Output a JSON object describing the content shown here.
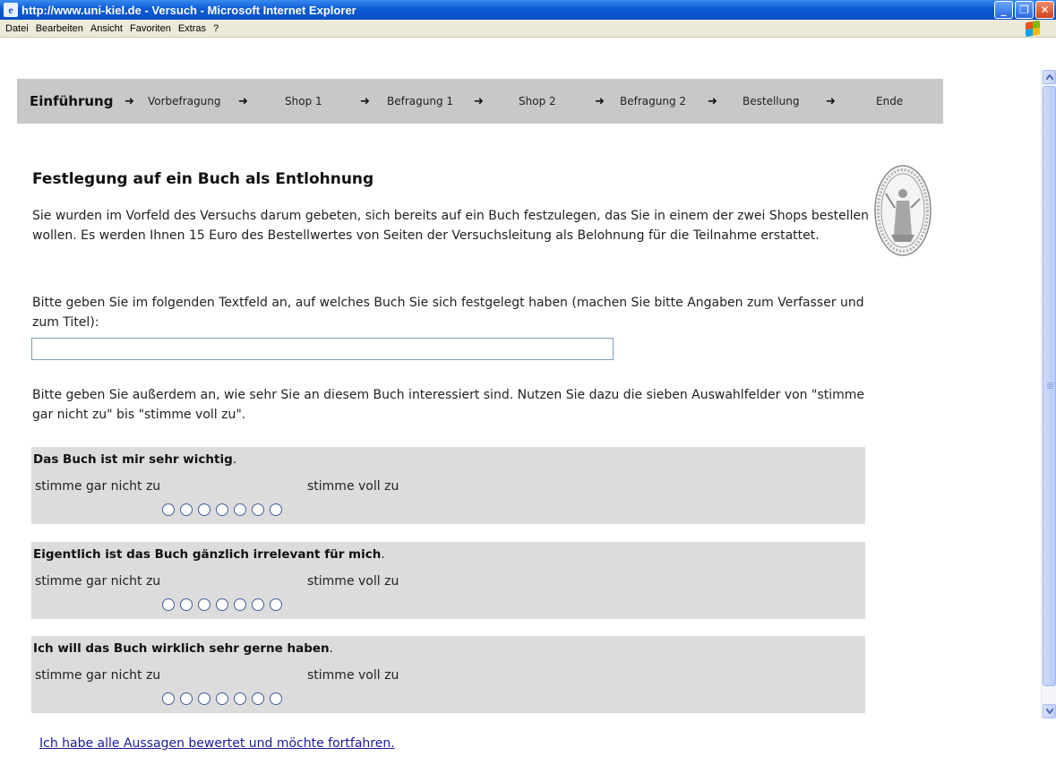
{
  "window": {
    "title": "http://www.uni-kiel.de - Versuch - Microsoft Internet Explorer",
    "app_icon": "e",
    "minimize_glyph": "_",
    "maximize_glyph": "❐",
    "close_glyph": "✕"
  },
  "menubar": {
    "items": [
      "Datei",
      "Bearbeiten",
      "Ansicht",
      "Favoriten",
      "Extras",
      "?"
    ]
  },
  "nav": {
    "arrow": "➜",
    "steps": [
      "Einführung",
      "Vorbefragung",
      "Shop 1",
      "Befragung 1",
      "Shop 2",
      "Befragung 2",
      "Bestellung",
      "Ende"
    ]
  },
  "content": {
    "title": "Festlegung auf ein Buch als Entlohnung",
    "intro": "Sie wurden im Vorfeld des Versuchs darum gebeten, sich bereits auf ein Buch festzulegen, das Sie in einem der zwei Shops bestellen wollen. Es werden Ihnen 15 Euro des Bestellwertes von Seiten der Versuchsleitung als Belohnung für die Teilnahme erstattet.",
    "input_prompt": "Bitte geben Sie im folgenden Textfeld an, auf welches Buch Sie sich festgelegt haben (machen Sie bitte Angaben zum Verfasser und zum Titel):",
    "book_input_value": "",
    "rating_prompt": "Bitte geben Sie außerdem an, wie sehr Sie an diesem Buch interessiert sind. Nutzen Sie dazu die sieben Auswahlfelder von \"stimme gar nicht zu\" bis \"stimme voll zu\".",
    "scale_low": "stimme gar nicht zu",
    "scale_high": "stimme voll zu",
    "questions": [
      {
        "text": "Das Buch ist mir sehr wichtig",
        "end": "."
      },
      {
        "text": "Eigentlich ist das Buch gänzlich irrelevant für mich",
        "end": "."
      },
      {
        "text": "Ich will das Buch wirklich sehr gerne haben",
        "end": "."
      }
    ],
    "continue_link": "Ich habe alle Aussagen bewertet und möchte fortfahren."
  },
  "icons": {
    "app": "ie-icon",
    "seal": "university-seal-icon",
    "windows_flag": "windows-flag-icon"
  }
}
